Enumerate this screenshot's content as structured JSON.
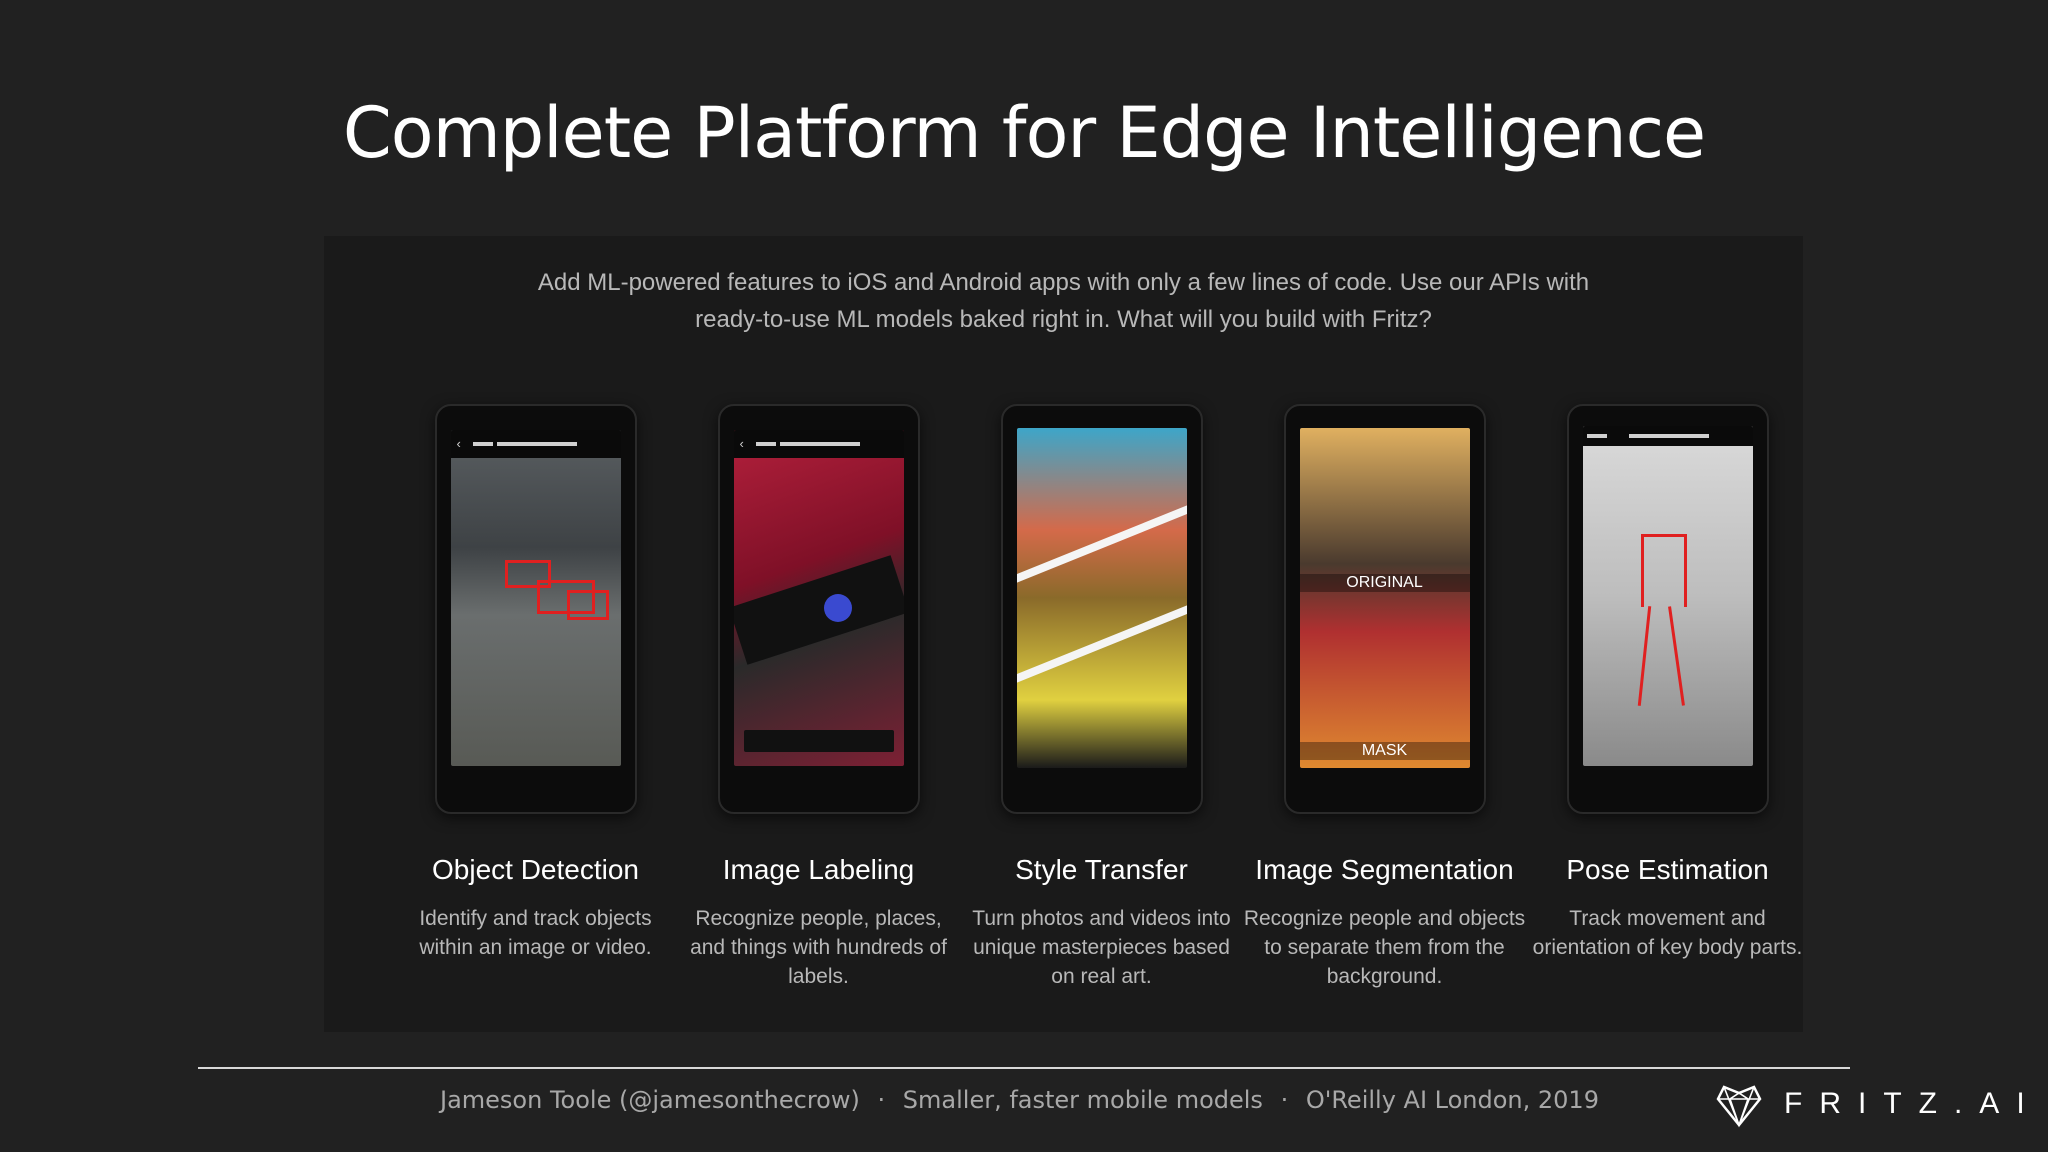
{
  "title": "Complete Platform for Edge Intelligence",
  "intro": {
    "line1": "Add ML-powered features to iOS and Android apps with only a few lines of code. Use our APIs with",
    "line2": "ready-to-use ML models baked right in. What will you build with Fritz?"
  },
  "features": [
    {
      "name": "Object Detection",
      "desc": "Identify and track objects within an image or video."
    },
    {
      "name": "Image Labeling",
      "desc": "Recognize people, places, and things with hundreds of labels."
    },
    {
      "name": "Style Transfer",
      "desc": "Turn photos and videos into unique masterpieces based on real art."
    },
    {
      "name": "Image Segmentation",
      "desc": "Recognize people and objects to separate them from the background."
    },
    {
      "name": "Pose Estimation",
      "desc": "Track movement and orientation of key body parts."
    }
  ],
  "screens": {
    "segmentation_top": "ORIGINAL",
    "segmentation_bottom": "MASK"
  },
  "footer": {
    "author": "Jameson Toole (@jamesonthecrow)",
    "talk": "Smaller, faster mobile models",
    "event": "O'Reilly AI London, 2019",
    "separator": "·"
  },
  "brand": {
    "name": "FRITZ.AI",
    "logo_icon": "heart-triangle-logo"
  }
}
